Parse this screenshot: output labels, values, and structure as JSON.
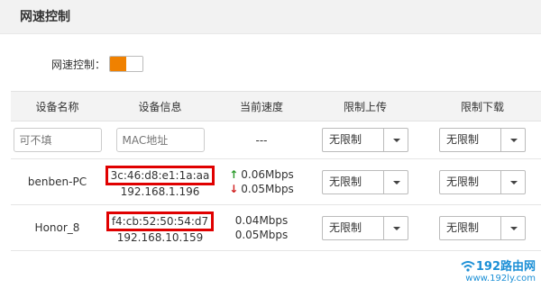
{
  "header": {
    "title": "网速控制"
  },
  "toggle": {
    "label": "网速控制：",
    "enabled": true,
    "accent": "#f08100"
  },
  "table": {
    "headers": [
      "设备名称",
      "设备信息",
      "当前速度",
      "限制上传",
      "限制下载"
    ],
    "input_row": {
      "name_placeholder": "可不填",
      "mac_placeholder": "MAC地址",
      "speed": "---",
      "upload": "无限制",
      "download": "无限制"
    },
    "devices": [
      {
        "name": "benben-PC",
        "mac": "3c:46:d8:e1:1a:aa",
        "ip": "192.168.1.196",
        "up": "0.06Mbps",
        "down": "0.05Mbps",
        "upload": "无限制",
        "download": "无限制"
      },
      {
        "name": "Honor_8",
        "mac": "f4:cb:52:50:54:d7",
        "ip": "192.168.10.159",
        "up": "0.04Mbps",
        "down": "0.05Mbps",
        "upload": "无限制",
        "download": "无限制"
      }
    ]
  },
  "watermark": {
    "brand": "192路由网",
    "url": "www.192ly.com"
  },
  "colors": {
    "highlight_box": "#e00000",
    "up_arrow": "#2a9a2a",
    "down_arrow": "#d02020",
    "watermark": "#1b8fd6"
  }
}
